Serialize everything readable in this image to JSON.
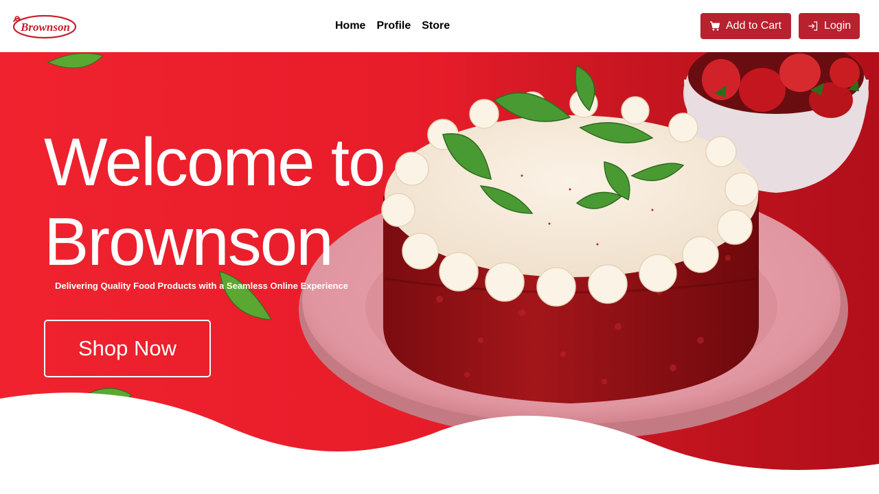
{
  "brand": {
    "logo_text": "Brownson"
  },
  "nav": {
    "links": [
      {
        "label": "Home"
      },
      {
        "label": "Profile"
      },
      {
        "label": "Store"
      }
    ]
  },
  "actions": {
    "cart_label": "Add to Cart",
    "cart_icon": "cart-icon",
    "login_label": "Login",
    "login_icon": "login-icon"
  },
  "hero": {
    "title_line1": "Welcome to",
    "title_line2": "Brownson",
    "subtitle": "Delivering Quality Food Products with a Seamless Online Experience",
    "cta_label": "Shop Now",
    "image": "red-velvet-cake-with-strawberries"
  },
  "colors": {
    "brand_red": "#b8212e",
    "hero_red": "#e81d2a",
    "nav_text": "#000000"
  }
}
